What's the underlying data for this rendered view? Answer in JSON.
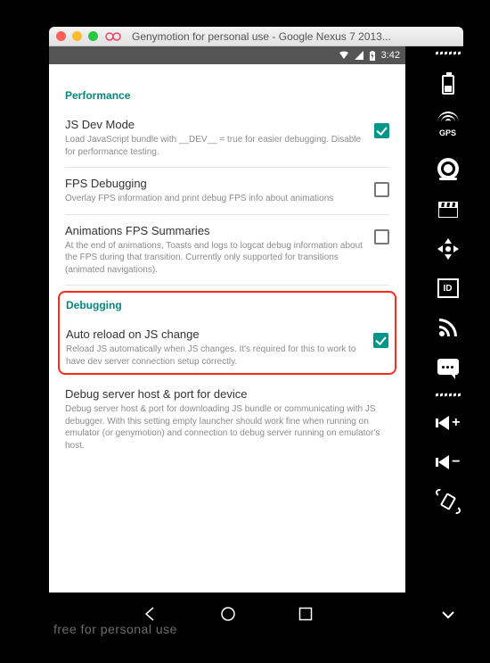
{
  "window": {
    "title": "Genymotion for personal use - Google Nexus 7 2013..."
  },
  "status": {
    "time": "3:42"
  },
  "sections": {
    "perf": {
      "header": "Performance",
      "jsdev": {
        "title": "JS Dev Mode",
        "desc": "Load JavaScript bundle with __DEV__ = true for easier debugging. Disable for performance testing."
      },
      "fps": {
        "title": "FPS Debugging",
        "desc": "Overlay FPS information and print debug FPS info about animations"
      },
      "animfps": {
        "title": "Animations FPS Summaries",
        "desc": "At the end of animations, Toasts and logs to logcat debug information about the FPS during that transition. Currently only supported for transitions (animated navigations)."
      }
    },
    "dbg": {
      "header": "Debugging",
      "autoreload": {
        "title": "Auto reload on JS change",
        "desc": "Reload JS automatically when JS changes. It's required for this to work to have dev server connection setup correctly."
      },
      "server": {
        "title": "Debug server host & port for device",
        "desc": "Debug server host & port for downloading JS bundle or communicating with JS debugger. With this setting empty launcher should work fine when running on emulator (or genymotion) and connection to debug server running on emulator's host."
      }
    }
  },
  "sidebar": {
    "gps": "GPS",
    "id": "ID",
    "plus": "+",
    "minus": "−"
  },
  "watermark": "free for personal use"
}
